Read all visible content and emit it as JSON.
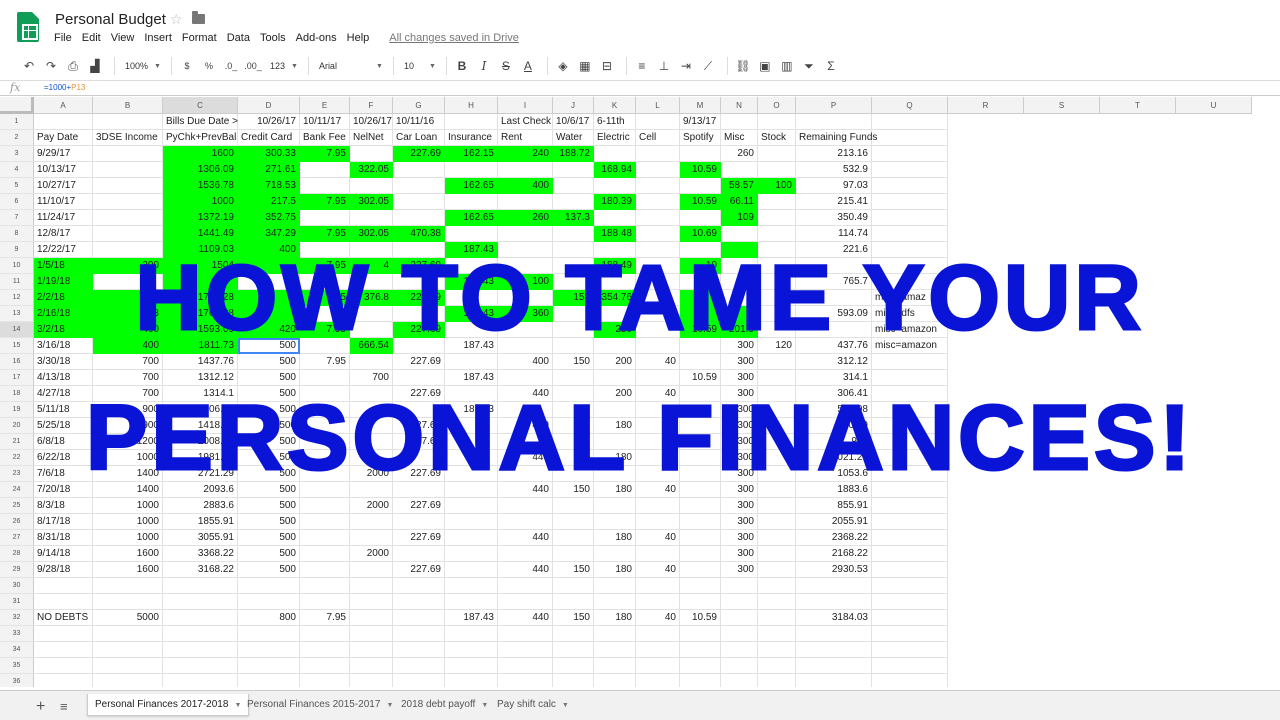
{
  "app": {
    "title": "Personal Budget",
    "menu": [
      "File",
      "Edit",
      "View",
      "Insert",
      "Format",
      "Data",
      "Tools",
      "Add-ons",
      "Help"
    ],
    "saved_status": "All changes saved in Drive"
  },
  "toolbar": {
    "zoom": "100%",
    "currency": "$",
    "percent": "%",
    "dec_decrease": ".0_",
    "dec_increase": ".00_",
    "more_formats": "123",
    "font": "Arial",
    "font_size": "10",
    "bold": "B",
    "italic": "I",
    "strike": "S",
    "text_color": "A",
    "functions": "Σ"
  },
  "formula_bar": {
    "prefix": "=1000+",
    "ref": "P13"
  },
  "columns": [
    "A",
    "B",
    "C",
    "D",
    "E",
    "F",
    "G",
    "H",
    "I",
    "J",
    "K",
    "L",
    "M",
    "N",
    "O",
    "P",
    "Q",
    "R",
    "S",
    "T",
    "U"
  ],
  "rows": [
    "1",
    "2",
    "3",
    "4",
    "5",
    "6",
    "7",
    "8",
    "9",
    "10",
    "11",
    "12",
    "13",
    "14",
    "15",
    "16",
    "17",
    "18",
    "19",
    "20",
    "21",
    "22",
    "23",
    "24",
    "25",
    "26",
    "27",
    "28",
    "29",
    "30",
    "31",
    "32",
    "33",
    "34",
    "35",
    "36"
  ],
  "cells": [
    [
      "",
      "",
      "Bills Due Date >",
      "10/26/17",
      "10/11/17",
      "10/26/17",
      "10/11/16",
      "",
      "Last Check",
      "10/6/17",
      "6-11th",
      "",
      "9/13/17",
      "",
      "",
      "",
      ""
    ],
    [
      "Pay Date",
      "3DSE Income",
      "PyChk+PrevBal",
      "Credit Card",
      "Bank Fee",
      "NelNet",
      "Car Loan",
      "Insurance",
      "Rent",
      "Water",
      "Electric",
      "Cell",
      "Spotify",
      "Misc",
      "Stock",
      "Remaining Funds",
      ""
    ],
    [
      "9/29/17",
      "",
      "1600",
      "300.33",
      "7.95",
      "",
      "227.69",
      "162.15",
      "240",
      "188.72",
      "",
      "",
      "",
      "260",
      "",
      "213.16",
      ""
    ],
    [
      "10/13/17",
      "",
      "1306.09",
      "271.61",
      "",
      "322.05",
      "",
      "",
      "",
      "",
      "168.94",
      "",
      "10.59",
      "",
      "",
      "532.9",
      ""
    ],
    [
      "10/27/17",
      "",
      "1536.78",
      "718.53",
      "",
      "",
      "",
      "162.65",
      "400",
      "",
      "",
      "",
      "",
      "58.57",
      "100",
      "97.03",
      ""
    ],
    [
      "11/10/17",
      "",
      "1000",
      "217.5",
      "7.95",
      "302.05",
      "",
      "",
      "",
      "",
      "180.39",
      "",
      "10.59",
      "66.11",
      "",
      "215.41",
      ""
    ],
    [
      "11/24/17",
      "",
      "1372.19",
      "352.75",
      "",
      "",
      "",
      "162.65",
      "260",
      "137.3",
      "",
      "",
      "",
      "109",
      "",
      "350.49",
      ""
    ],
    [
      "12/8/17",
      "",
      "1441.49",
      "347.29",
      "7.95",
      "302.05",
      "470.38",
      "",
      "",
      "",
      "188.48",
      "",
      "10.69",
      "",
      "",
      "114.74",
      ""
    ],
    [
      "12/22/17",
      "",
      "1109.03",
      "400",
      "",
      "",
      "",
      "187.43",
      "",
      "",
      "",
      "",
      "",
      "",
      "",
      "221.6",
      ""
    ],
    [
      "1/5/18",
      "300",
      "1504",
      "",
      "7.95",
      "4",
      "227.69",
      "",
      "",
      "",
      "188.49",
      "",
      "10",
      "",
      "",
      "",
      ""
    ],
    [
      "1/19/18",
      "",
      "",
      "",
      "",
      "",
      "",
      "187.43",
      "100",
      "",
      "",
      "",
      "",
      "",
      "",
      "765.7",
      ""
    ],
    [
      "2/2/18",
      "",
      "1764.28",
      "",
      "7.95",
      "376.8",
      "227.69",
      "",
      "",
      "153",
      "354.76",
      "",
      "",
      "",
      "",
      "",
      "misc=amaz"
    ],
    [
      "2/16/18",
      "613",
      "1764.28",
      "",
      "",
      "",
      "",
      "187.43",
      "360",
      "",
      "",
      "",
      "",
      "",
      "",
      "593.09",
      "misc=dfs"
    ],
    [
      "3/2/18",
      "400",
      "1593.09",
      "420",
      "7.95",
      "",
      "227.69",
      "",
      "",
      "",
      "250",
      "",
      "10.59",
      "201.9",
      "",
      "",
      "misc=amazon"
    ],
    [
      "3/16/18",
      "400",
      "1811.73",
      "500",
      "",
      "666.54",
      "",
      "187.43",
      "",
      "",
      "",
      "",
      "",
      "300",
      "120",
      "437.76",
      "misc=amazon"
    ],
    [
      "3/30/18",
      "700",
      "1437.76",
      "500",
      "7.95",
      "",
      "227.69",
      "",
      "400",
      "150",
      "200",
      "40",
      "",
      "300",
      "",
      "312.12",
      ""
    ],
    [
      "4/13/18",
      "700",
      "1312.12",
      "500",
      "",
      "700",
      "",
      "187.43",
      "",
      "",
      "",
      "",
      "10.59",
      "300",
      "",
      "314.1",
      ""
    ],
    [
      "4/27/18",
      "700",
      "1314.1",
      "500",
      "",
      "",
      "227.69",
      "",
      "440",
      "",
      "200",
      "40",
      "",
      "300",
      "",
      "306.41",
      ""
    ],
    [
      "5/11/18",
      "900",
      "1206.41",
      "500",
      "",
      "",
      "",
      "187.43",
      "",
      "",
      "",
      "",
      "",
      "300",
      "",
      "518.98",
      ""
    ],
    [
      "5/25/18",
      "900",
      "1418.98",
      "500",
      "",
      "",
      "227.69",
      "",
      "440",
      "150",
      "180",
      "40",
      "",
      "300",
      "",
      "808.9",
      ""
    ],
    [
      "6/8/18",
      "1200",
      "2008.98",
      "500",
      "",
      "",
      "227.69",
      "",
      "",
      "",
      "",
      "",
      "",
      "300",
      "",
      "981",
      ""
    ],
    [
      "6/22/18",
      "1000",
      "1981.29",
      "500",
      "",
      "",
      "",
      "",
      "440",
      "",
      "180",
      "40",
      "",
      "300",
      "",
      "1021.29",
      ""
    ],
    [
      "7/6/18",
      "1400",
      "2721.29",
      "500",
      "",
      "2000",
      "227.69",
      "",
      "",
      "",
      "",
      "",
      "",
      "300",
      "",
      "1053.6",
      ""
    ],
    [
      "7/20/18",
      "1400",
      "2093.6",
      "500",
      "",
      "",
      "",
      "",
      "440",
      "150",
      "180",
      "40",
      "",
      "300",
      "",
      "1883.6",
      ""
    ],
    [
      "8/3/18",
      "1000",
      "2883.6",
      "500",
      "",
      "2000",
      "227.69",
      "",
      "",
      "",
      "",
      "",
      "",
      "300",
      "",
      "855.91",
      ""
    ],
    [
      "8/17/18",
      "1000",
      "1855.91",
      "500",
      "",
      "",
      "",
      "",
      "",
      "",
      "",
      "",
      "",
      "300",
      "",
      "2055.91",
      ""
    ],
    [
      "8/31/18",
      "1000",
      "3055.91",
      "500",
      "",
      "",
      "227.69",
      "",
      "440",
      "",
      "180",
      "40",
      "",
      "300",
      "",
      "2368.22",
      ""
    ],
    [
      "9/14/18",
      "1600",
      "3368.22",
      "500",
      "",
      "2000",
      "",
      "",
      "",
      "",
      "",
      "",
      "",
      "300",
      "",
      "2168.22",
      ""
    ],
    [
      "9/28/18",
      "1600",
      "3168.22",
      "500",
      "",
      "",
      "227.69",
      "",
      "440",
      "150",
      "180",
      "40",
      "",
      "300",
      "",
      "2930.53",
      ""
    ],
    [
      "",
      "",
      "",
      "",
      "",
      "",
      "",
      "",
      "",
      "",
      "",
      "",
      "",
      "",
      "",
      "",
      ""
    ],
    [
      "",
      "",
      "",
      "",
      "",
      "",
      "",
      "",
      "",
      "",
      "",
      "",
      "",
      "",
      "",
      "",
      ""
    ],
    [
      "NO DEBTS",
      "5000",
      "",
      "800",
      "7.95",
      "",
      "",
      "187.43",
      "440",
      "150",
      "180",
      "40",
      "10.59",
      "",
      "",
      "3184.03",
      ""
    ],
    [
      "",
      "",
      "",
      "",
      "",
      "",
      "",
      "",
      "",
      "",
      "",
      "",
      "",
      "",
      "",
      "",
      ""
    ],
    [
      "",
      "",
      "",
      "",
      "",
      "",
      "",
      "",
      "",
      "",
      "",
      "",
      "",
      "",
      "",
      "",
      ""
    ],
    [
      "",
      "",
      "",
      "",
      "",
      "",
      "",
      "",
      "",
      "",
      "",
      "",
      "",
      "",
      "",
      "",
      ""
    ],
    [
      "",
      "",
      "",
      "",
      "",
      "",
      "",
      "",
      "",
      "",
      "",
      "",
      "",
      "",
      "",
      "",
      ""
    ]
  ],
  "green_cells": [
    [
      3,
      [
        2,
        3,
        4,
        6,
        7,
        8,
        9
      ]
    ],
    [
      4,
      [
        2,
        3,
        5,
        10,
        12
      ]
    ],
    [
      5,
      [
        2,
        3,
        7,
        8,
        13,
        14
      ]
    ],
    [
      6,
      [
        2,
        3,
        4,
        5,
        10,
        12,
        13
      ]
    ],
    [
      7,
      [
        2,
        3,
        7,
        8,
        9,
        13
      ]
    ],
    [
      8,
      [
        2,
        3,
        4,
        5,
        6,
        10,
        12
      ]
    ],
    [
      9,
      [
        2,
        3,
        7,
        13
      ]
    ],
    [
      10,
      [
        0,
        1,
        2,
        3,
        4,
        5,
        6,
        10,
        12
      ]
    ],
    [
      11,
      [
        0,
        2,
        7,
        8
      ]
    ],
    [
      12,
      [
        0,
        1,
        2,
        3,
        4,
        5,
        6,
        9,
        10,
        12
      ]
    ],
    [
      13,
      [
        0,
        1,
        2,
        3,
        7,
        8,
        12,
        13
      ]
    ],
    [
      14,
      [
        0,
        1,
        2,
        3,
        4,
        6,
        10,
        12,
        13
      ]
    ],
    [
      15,
      [
        1,
        2,
        5
      ]
    ]
  ],
  "overlay": {
    "line1": "HOW TO TAME YOUR",
    "line2": "PERSONAL FINANCES!"
  },
  "sheet_tabs": [
    {
      "label": "Personal Finances 2017-2018",
      "active": true
    },
    {
      "label": "Personal Finances 2015-2017",
      "active": false
    },
    {
      "label": "2018 debt payoff",
      "active": false
    },
    {
      "label": "Pay shift calc",
      "active": false
    }
  ]
}
